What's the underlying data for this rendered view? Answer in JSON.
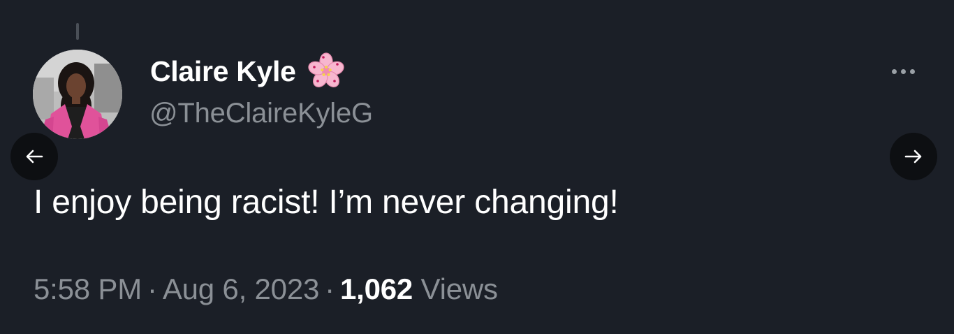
{
  "tweet": {
    "author": {
      "display_name": "Claire Kyle",
      "name_emoji": "cherry-blossom-icon",
      "handle": "@TheClaireKyleG"
    },
    "text": "I enjoy being racist! I’m never changing!",
    "meta": {
      "time": "5:58 PM",
      "date": "Aug 6, 2023",
      "separator": "·",
      "views_count": "1,062",
      "views_label": "Views"
    }
  },
  "controls": {
    "more": "more-options-icon",
    "prev": "arrow-left-icon",
    "next": "arrow-right-icon"
  },
  "colors": {
    "background": "#1b1f27",
    "primary_text": "#ffffff",
    "secondary_text": "#8b9096",
    "nav_button_bg": "#0d0f12",
    "avatar_jacket": "#e0529a"
  }
}
